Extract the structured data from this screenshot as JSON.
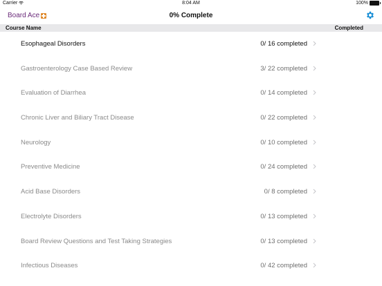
{
  "status": {
    "carrier": "Carrier",
    "time": "8:04 AM",
    "battery": "100%"
  },
  "nav": {
    "brand": "Board Ace",
    "title": "0% Complete"
  },
  "header": {
    "course_name": "Course Name",
    "completed": "Completed"
  },
  "courses": [
    {
      "name": "Esophageal Disorders",
      "progress": "0/ 16 completed"
    },
    {
      "name": "Gastroenterology Case Based Review",
      "progress": "3/ 22 completed"
    },
    {
      "name": "Evaluation of Diarrhea",
      "progress": "0/ 14 completed"
    },
    {
      "name": "Chronic Liver and Biliary Tract Disease",
      "progress": "0/ 22 completed"
    },
    {
      "name": "Neurology",
      "progress": "0/ 10 completed"
    },
    {
      "name": "Preventive Medicine",
      "progress": "0/ 24 completed"
    },
    {
      "name": "Acid Base Disorders",
      "progress": "0/ 8 completed"
    },
    {
      "name": "Electrolyte Disorders",
      "progress": "0/ 13 completed"
    },
    {
      "name": "Board Review Questions and Test Taking Strategies",
      "progress": "0/ 13 completed"
    },
    {
      "name": "Infectious Diseases",
      "progress": "0/ 42 completed"
    }
  ],
  "colors": {
    "brand": "#6a2b7a",
    "accent": "#1a8fd6",
    "header_bg": "#e8e8ea"
  },
  "icons": {
    "brand_mark": "plus-badge-icon",
    "settings": "gear-icon",
    "row_disclosure": "chevron-right-icon",
    "wifi": "wifi-icon",
    "battery": "battery-icon"
  }
}
